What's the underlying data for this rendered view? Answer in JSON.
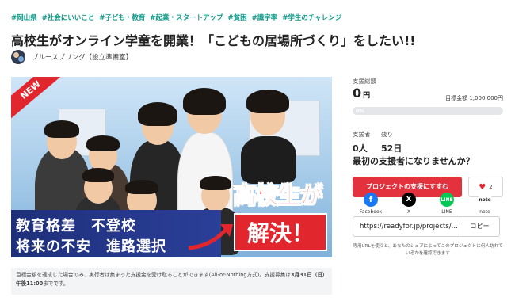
{
  "tags": [
    "#岡山県",
    "#社会にいいこと",
    "#子ども・教育",
    "#起業・スタートアップ",
    "#貧困",
    "#識字率",
    "#学生のチャレンジ"
  ],
  "title": "高校生がオンライン学童を開業！「こどもの居場所づくり」をしたい!!",
  "owner": {
    "name": "ブルースプリング【設立準備室】"
  },
  "hero": {
    "badge": "NEW",
    "issues_line1": "教育格差　不登校",
    "issues_line2": "将来の不安　進路選択",
    "solve_line1": "高校生が",
    "solve_line2": "解決！"
  },
  "note": {
    "text": "目標金額を達成した場合のみ、実行者は集まった支援金を受け取ることができます(All-or-Nothing方式)。支援募集は",
    "deadline": "3月31日（日）午後11:00",
    "suffix": "までです。"
  },
  "panel": {
    "total_label": "支援総額",
    "total_amount": "0",
    "total_unit": "円",
    "goal_label": "目標金額",
    "goal_amount": "1,000,000円",
    "progress_label": "0%",
    "progress_fraction": 0,
    "supporters_label": "支援者",
    "supporters_value": "0人",
    "remaining_label": "残り",
    "remaining_value": "52日",
    "first_supporter": "最初の支援者になりませんか？",
    "support_button": "プロジェクトの支援にすすむ",
    "like_count": "2",
    "share_url": "https://readyfor.jp/projects/...",
    "copy_button": "コピー",
    "share_note": "専用URLを使うと、あなたのシェアによってこのプロジェクトに何人訪れているかを確認できます"
  },
  "sns": [
    {
      "label": "Facebook",
      "icon": "facebook-icon",
      "color": "#1877f2",
      "glyph": "f"
    },
    {
      "label": "X",
      "icon": "x-icon",
      "color": "#000000",
      "glyph": "𝕏"
    },
    {
      "label": "LINE",
      "icon": "line-icon",
      "color": "#06c755",
      "glyph": "L"
    },
    {
      "label": "note",
      "icon": "note-icon",
      "color": "#ffffff",
      "glyph": "note"
    }
  ]
}
